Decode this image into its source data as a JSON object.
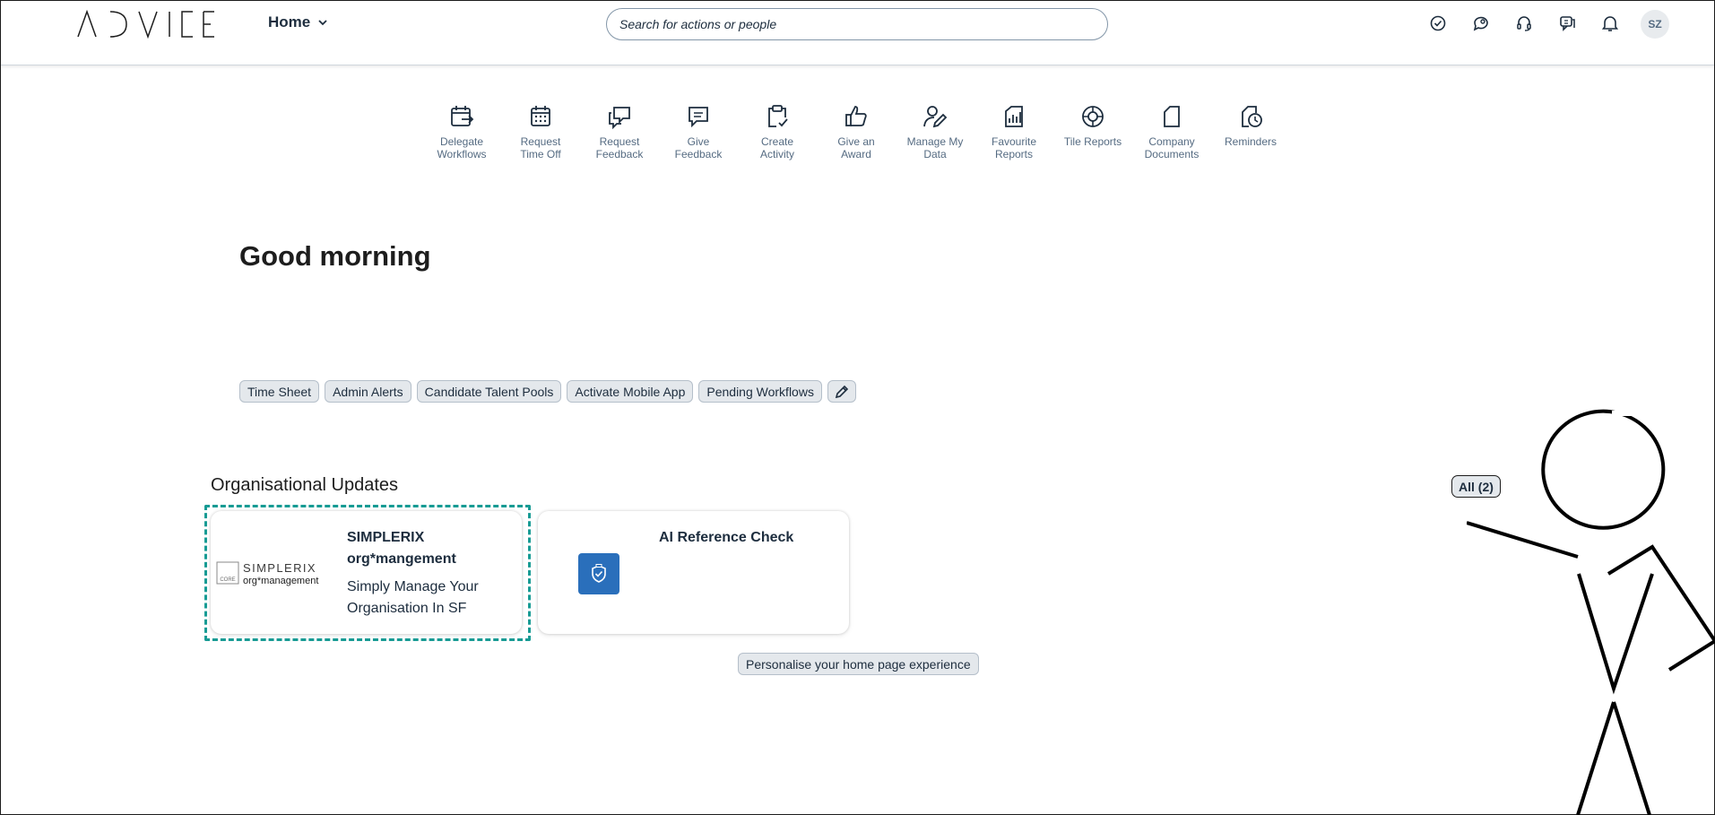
{
  "header": {
    "logo_text": "ADVICE",
    "home_menu_label": "Home",
    "search_placeholder": "Search for actions or people",
    "icons": [
      "check-circle-icon",
      "chat-support-icon",
      "headset-icon",
      "feedback-icon",
      "bell-icon"
    ],
    "avatar_initials": "SZ"
  },
  "quick_actions": [
    {
      "label": "Delegate\nWorkflows",
      "icon": "calendar-arrow-icon"
    },
    {
      "label": "Request\nTime Off",
      "icon": "calendar-icon"
    },
    {
      "label": "Request\nFeedback",
      "icon": "feedback-request-icon"
    },
    {
      "label": "Give\nFeedback",
      "icon": "message-icon"
    },
    {
      "label": "Create\nActivity",
      "icon": "clipboard-check-icon"
    },
    {
      "label": "Give an\nAward",
      "icon": "thumbs-up-icon"
    },
    {
      "label": "Manage My\nData",
      "icon": "person-edit-icon"
    },
    {
      "label": "Favourite\nReports",
      "icon": "report-icon"
    },
    {
      "label": "Tile Reports",
      "icon": "target-icon"
    },
    {
      "label": "Company\nDocuments",
      "icon": "document-icon"
    },
    {
      "label": "Reminders",
      "icon": "reminder-clock-icon"
    }
  ],
  "greeting": "Good morning",
  "chips": [
    "Time Sheet",
    "Admin Alerts",
    "Candidate Talent Pools",
    "Activate Mobile App",
    "Pending Workflows"
  ],
  "section": {
    "title": "Organisational Updates",
    "all_label": "All (2)"
  },
  "cards": [
    {
      "title": "SIMPLERIX org*mangement",
      "subtitle": "Simply Manage Your Organisation In SF",
      "logo_line1": "SIMPLERIX",
      "logo_line2": "org*management",
      "logo_badge": "CORE"
    },
    {
      "title": "AI Reference Check",
      "subtitle": ""
    }
  ],
  "personalise_label": "Personalise your home page experience",
  "colors": {
    "accent": "#2a6fbb",
    "focus": "#179b94",
    "chip_bg": "#e4e8ec"
  }
}
